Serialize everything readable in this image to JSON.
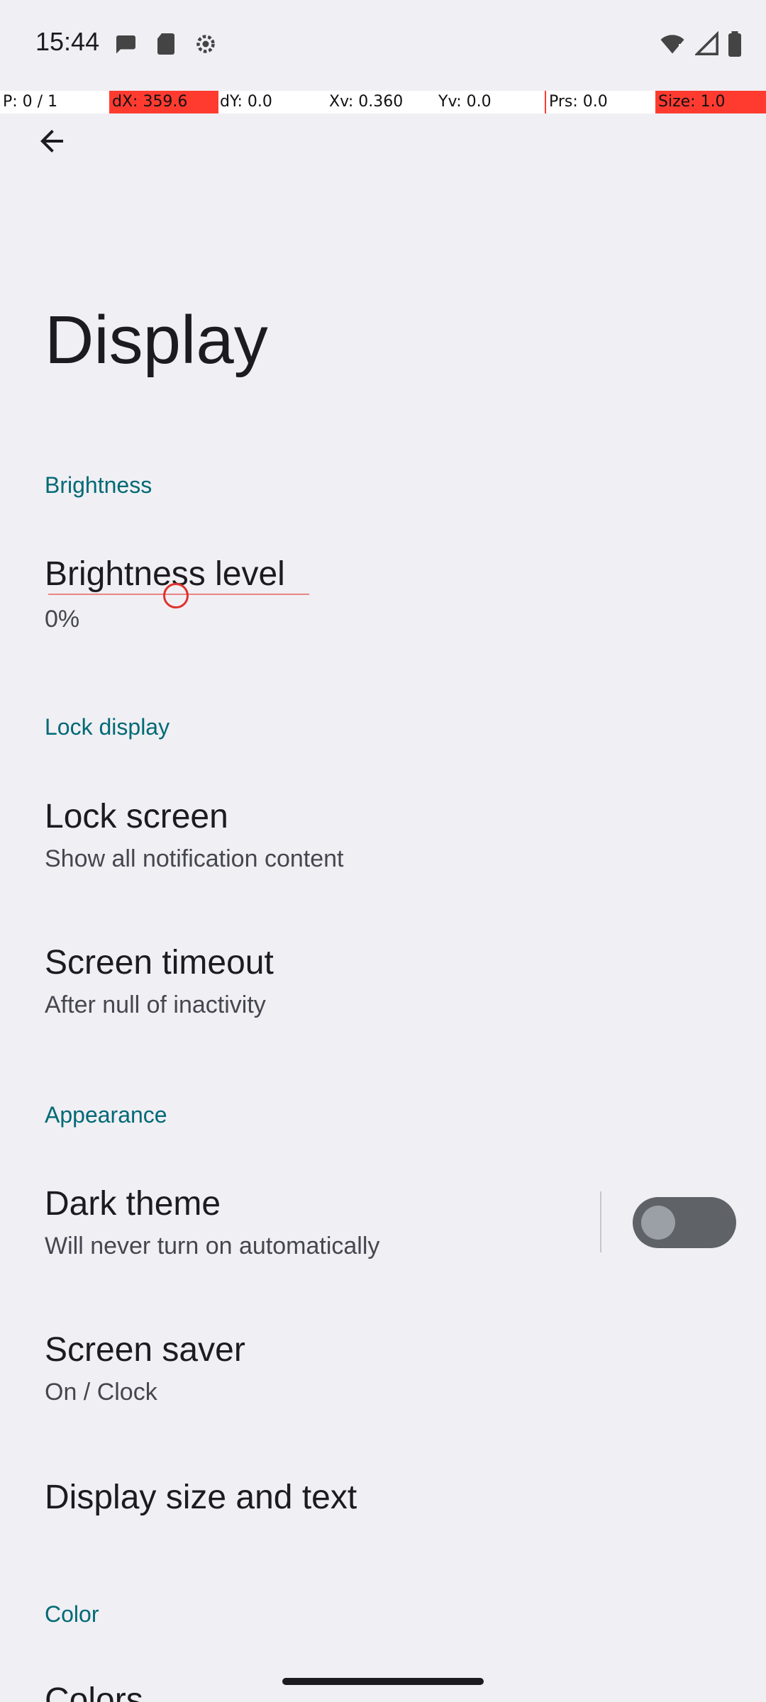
{
  "status_bar": {
    "time": "15:44",
    "left_icons": [
      "chat-bubble-icon",
      "sd-card-icon",
      "settings-gear-icon"
    ],
    "right_icons": [
      "wifi-alert-icon",
      "signal-icon",
      "battery-icon"
    ]
  },
  "debug_overlay": {
    "pointer": "P: 0 / 1",
    "dx": "dX: 359.6",
    "dy": "dY: 0.0",
    "xv": "Xv: 0.360",
    "yv": "Yv: 0.0",
    "prs": "Prs: 0.0",
    "size": "Size: 1.0"
  },
  "toolbar": {
    "back_icon": "arrow-back-icon"
  },
  "page_title": "Display",
  "sections": {
    "brightness": {
      "header": "Brightness",
      "level_title": "Brightness level",
      "level_value": "0%"
    },
    "lock_display": {
      "header": "Lock display",
      "lock_screen_title": "Lock screen",
      "lock_screen_sub": "Show all notification content",
      "timeout_title": "Screen timeout",
      "timeout_sub": "After null of inactivity"
    },
    "appearance": {
      "header": "Appearance",
      "dark_theme_title": "Dark theme",
      "dark_theme_sub": "Will never turn on automatically",
      "dark_theme_enabled": false,
      "screen_saver_title": "Screen saver",
      "screen_saver_sub": "On / Clock",
      "display_size_title": "Display size and text"
    },
    "color": {
      "header": "Color",
      "colors_title": "Colors"
    }
  },
  "colors": {
    "background": "#f0eff4",
    "accent": "#006a75",
    "debug_red": "#ff3b30"
  }
}
